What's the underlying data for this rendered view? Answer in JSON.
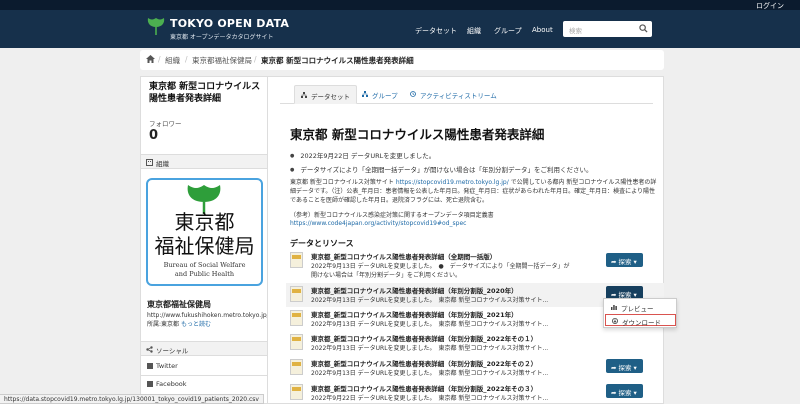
{
  "topbar": {
    "login": "ログイン"
  },
  "brand": {
    "title": "TOKYO OPEN DATA",
    "subtitle": "東京都 オープンデータカタログサイト"
  },
  "nav": [
    "データセット",
    "組織",
    "グループ",
    "About"
  ],
  "search": {
    "placeholder": "検索"
  },
  "breadcrumb": [
    "組織",
    "東京都福祉保健局",
    "東京都 新型コロナウイルス陽性患者発表詳細"
  ],
  "sidebar": {
    "title": "東京都 新型コロナウイルス陽性患者発表詳細",
    "followers_label": "フォロワー",
    "followers_count": "0",
    "org_section": "組織",
    "org_logo": {
      "line1": "東京都",
      "line2": "福祉保健局",
      "en1": "Bureau of Social Welfare",
      "en2": "and Public Health"
    },
    "org_name": "東京都福祉保健局",
    "org_desc": "http://www.fukushihoken.metro.tokyo.jp/ 所属:東京都",
    "org_more": "もっと読む",
    "social_section": "ソーシャル",
    "social": [
      "Twitter",
      "Facebook"
    ]
  },
  "tabs": [
    "データセット",
    "グループ",
    "アクティビティストリーム"
  ],
  "dataset": {
    "title": "東京都 新型コロナウイルス陽性患者発表詳細",
    "bullets": [
      "2022年9月22日 データURLを変更しました。",
      "データサイズにより「全期間一括データ」が開けない場合は「年別分割データ」をご利用ください。"
    ],
    "desc_lead": "東京都 新型コロナウイルス対策サイト",
    "desc_link": "https://stopcovid19.metro.tokyo.lg.jp/",
    "desc_rest": " で公開している都内 新型コロナウイルス陽性患者の詳細データです。（注）公表_年月日：患者情報を公表した年月日。発症_年月日：症状があらわれた年月日。確定_年月日：検査により陽性であることを医師が確認した年月日。退院済フラグには、死亡退院含む。",
    "ref_text": "（参考）新型コロナウイルス感染症対策に関するオープンデータ項目定義書",
    "ref_link": "https://www.code4japan.org/activity/stopcovid19#od_spec"
  },
  "resources_heading": "データとリソース",
  "resources": [
    {
      "title": "東京都_新型コロナウイルス陽性患者発表詳細（全期間一括版）",
      "desc": "2022年9月13日 データURLを変更しました。　●　データサイズにより「全期間一括データ」が開けない場合は「年別分割データ」をご利用ください。"
    },
    {
      "title": "東京都_新型コロナウイルス陽性患者発表詳細（年別分割版_2020年）",
      "desc": "2022年9月13日 データURLを変更しました。　東京都 新型コロナウイルス対策サイト..."
    },
    {
      "title": "東京都_新型コロナウイルス陽性患者発表詳細（年別分割版_2021年）",
      "desc": "2022年9月13日 データURLを変更しました。　東京都 新型コロナウイルス対策サイト..."
    },
    {
      "title": "東京都_新型コロナウイルス陽性患者発表詳細（年別分割版_2022年その１）",
      "desc": "2022年9月13日 データURLを変更しました。　東京都 新型コロナウイルス対策サイト..."
    },
    {
      "title": "東京都_新型コロナウイルス陽性患者発表詳細（年別分割版_2022年その２）",
      "desc": "2022年9月13日 データURLを変更しました。　東京都 新型コロナウイルス対策サイト..."
    },
    {
      "title": "東京都_新型コロナウイルス陽性患者発表詳細（年別分割版_2022年その３）",
      "desc": "2022年9月22日 データURLを変更しました。　東京都 新型コロナウイルス対策サイト..."
    }
  ],
  "explore_label": "探索",
  "dropdown": [
    "プレビュー",
    "ダウンロード"
  ],
  "status_url": "https://data.stopcovid19.metro.tokyo.lg.jp/130001_tokyo_covid19_patients_2020.csv",
  "colors": {
    "masthead": "#16304b",
    "topbar": "#0b1b2e",
    "button": "#1f5f86",
    "link": "#1e6aa7",
    "highlight": "#d9534f"
  }
}
